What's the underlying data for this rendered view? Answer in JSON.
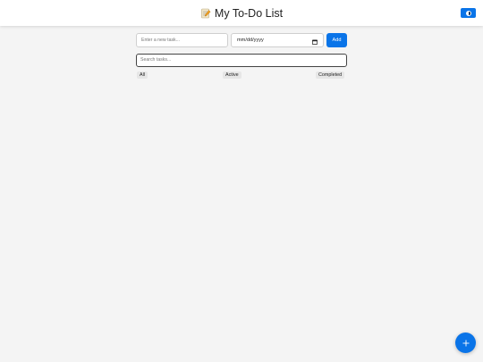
{
  "header": {
    "icon": "memo-icon",
    "title": "My To-Do List",
    "theme_toggle_icon": "contrast-icon"
  },
  "form": {
    "task_placeholder": "Enter a new task...",
    "date_value": "mm/dd/yyyy",
    "date_icon": "calendar-icon",
    "add_label": "Add"
  },
  "search": {
    "placeholder": "Search tasks..."
  },
  "filters": {
    "all": "All",
    "active": "Active",
    "completed": "Completed"
  },
  "fab": {
    "icon": "plus-icon"
  },
  "colors": {
    "accent": "#0a74e8",
    "background": "#f4f4f4",
    "header": "#ffffff"
  }
}
